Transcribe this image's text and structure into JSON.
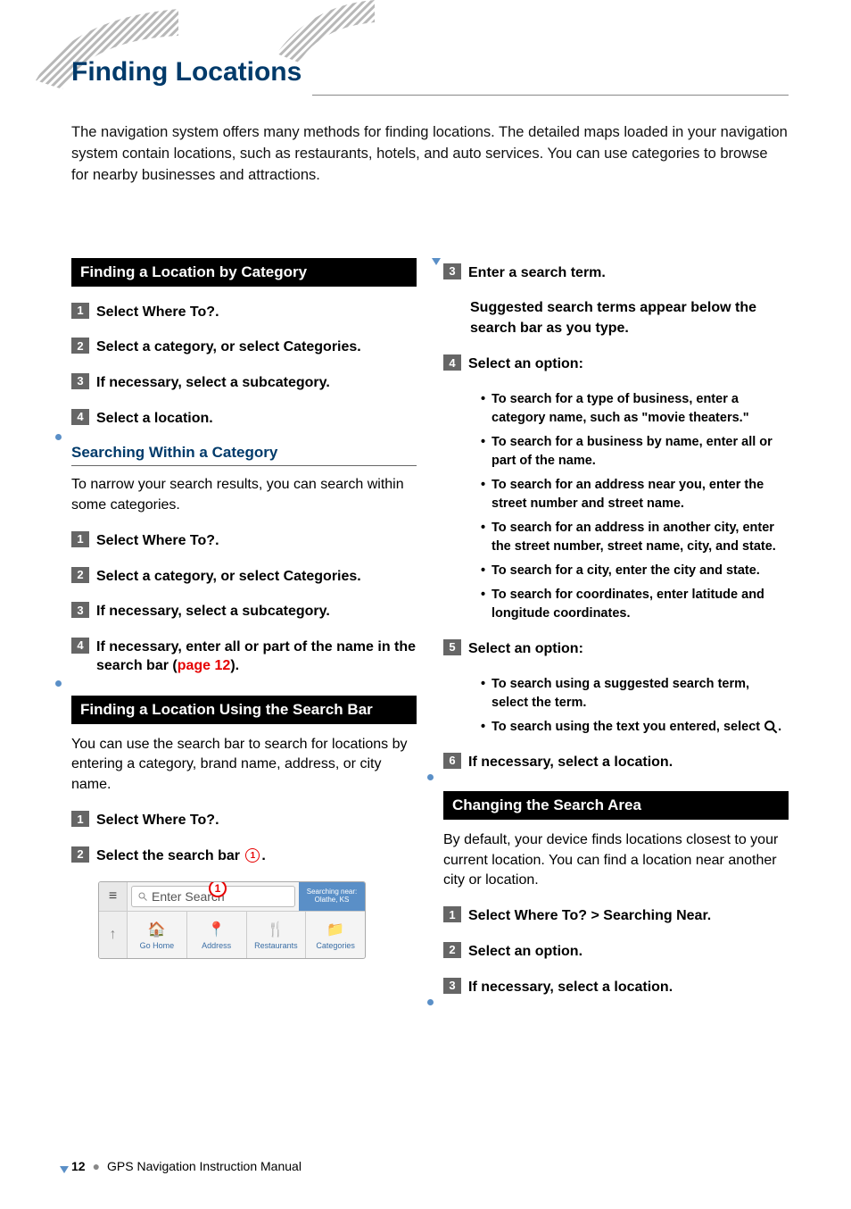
{
  "chapter_title": "Finding Locations",
  "intro": "The navigation system offers many methods for finding locations. The detailed maps loaded in your navigation system contain locations, such as restaurants, hotels, and auto services. You can use categories to browse for nearby businesses and attractions.",
  "left": {
    "sec1": {
      "title": "Finding a Location by Category",
      "steps": [
        "Select Where To?.",
        "Select a category, or select Categories.",
        "If necessary, select a subcategory.",
        "Select a location."
      ]
    },
    "sec2": {
      "title": "Searching Within a Category",
      "body": "To narrow your search results, you can search within some categories.",
      "steps": [
        "Select Where To?.",
        "Select a category, or select Categories.",
        "If necessary, select a subcategory.",
        "If necessary, enter all or part of the name in the search bar ("
      ],
      "step4_link": "page 12",
      "step4_tail": ")."
    },
    "sec3": {
      "title": "Finding a Location Using the Search Bar",
      "body": "You can use the search bar to search for locations by entering a category, brand name, address, or city name.",
      "steps": [
        "Select Where To?.",
        "Select the search bar "
      ],
      "step2_tail": "."
    }
  },
  "right": {
    "cont": {
      "step3": "Enter a search term.",
      "step3_body": "Suggested search terms appear below the search bar as you type.",
      "step4": "Select an option:",
      "step4_bullets": [
        "To search for a type of business, enter a category name, such as \"movie theaters.\"",
        "To search for a business by name, enter all or part of the name.",
        "To search for an address near you, enter the street number and street name.",
        "To search for an address in another city, enter the street number, street name, city, and state.",
        "To search for a city, enter the city and state.",
        "To search for coordinates, enter latitude and longitude coordinates."
      ],
      "step5": "Select an option:",
      "step5_bullets": [
        "To search using a suggested search term, select the term.",
        "To search using the text you entered, select "
      ],
      "step5_b2_tail": ".",
      "step6": "If necessary, select a location."
    },
    "sec4": {
      "title": "Changing the Search Area",
      "body": "By default, your device finds locations closest to your current location. You can find a location near another city or location.",
      "steps": [
        "Select Where To? > Searching Near.",
        "Select an option.",
        "If necessary, select a location."
      ]
    }
  },
  "screenshot": {
    "search_placeholder": "Enter Search",
    "near_label1": "Searching near:",
    "near_label2": "Olathe, KS",
    "items": [
      "Go Home",
      "Address",
      "Restaurants",
      "Categories"
    ]
  },
  "footer": {
    "page": "12",
    "manual": "GPS Navigation Instruction Manual"
  }
}
